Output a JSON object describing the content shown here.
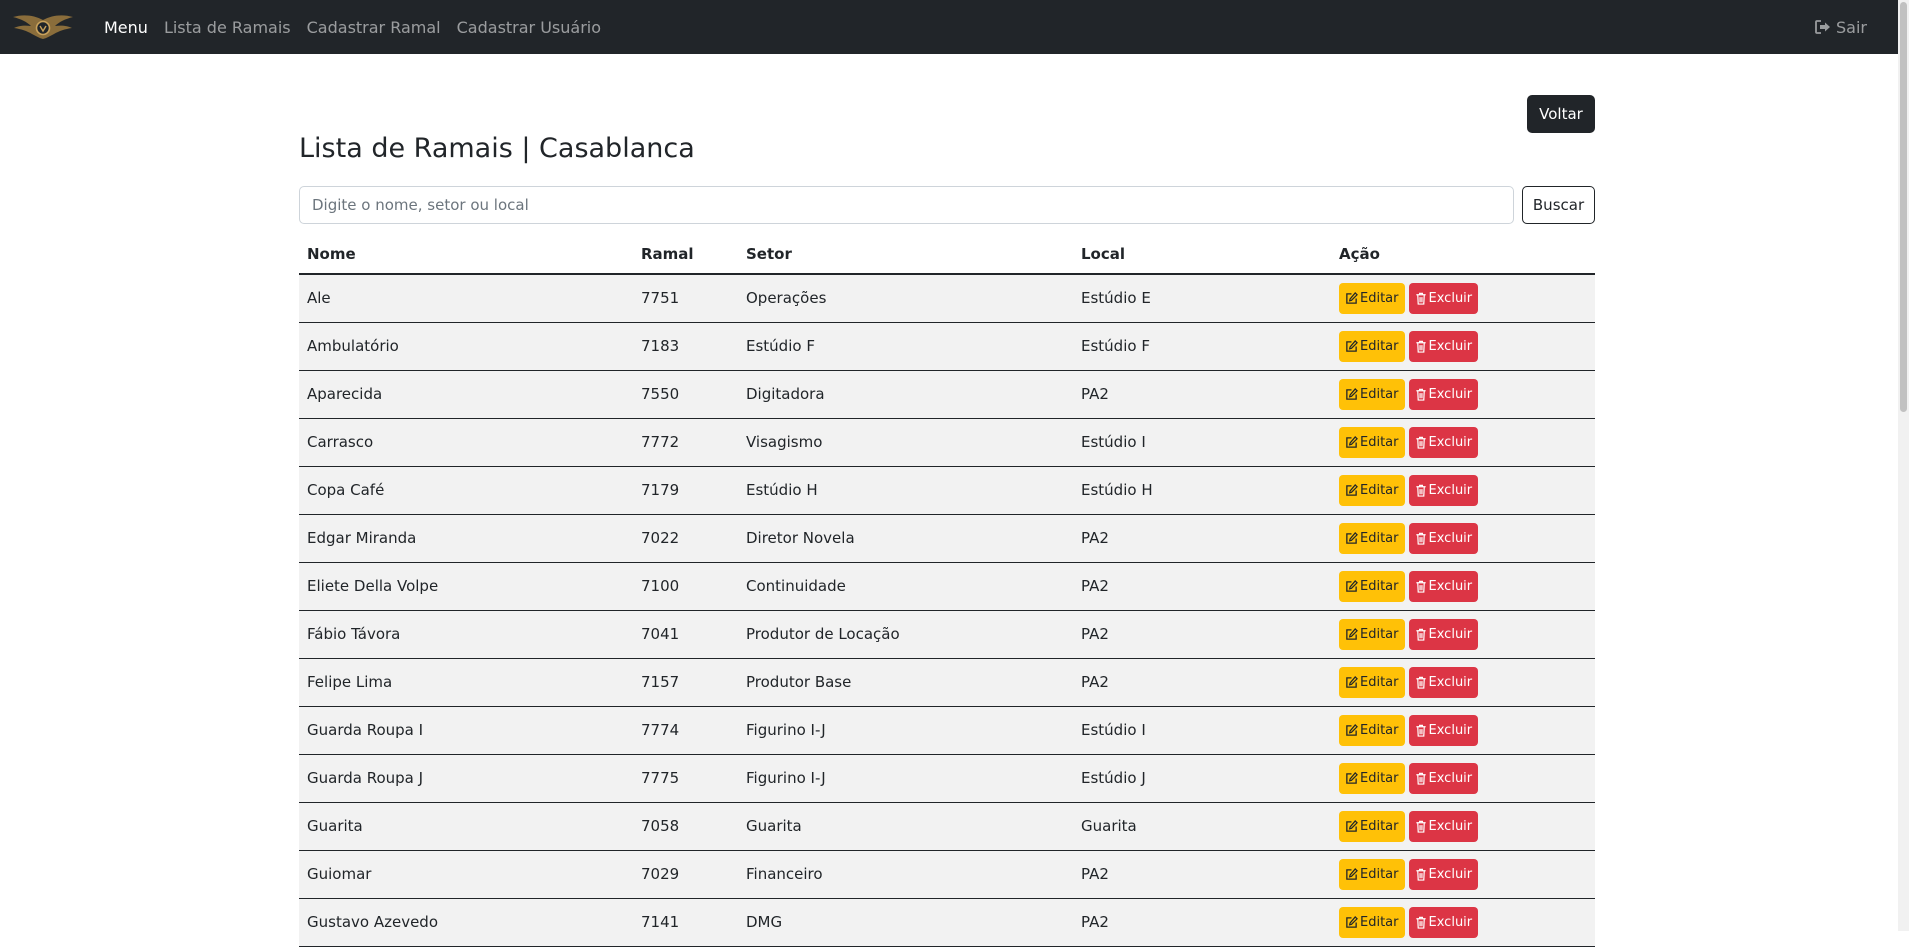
{
  "navbar": {
    "brand_icon": "winged-emblem-logo",
    "links": [
      {
        "label": "Menu",
        "active": true
      },
      {
        "label": "Lista de Ramais",
        "active": false
      },
      {
        "label": "Cadastrar Ramal",
        "active": false
      },
      {
        "label": "Cadastrar Usuário",
        "active": false
      }
    ],
    "logout_label": "Sair",
    "logout_icon": "sign-out-icon"
  },
  "main": {
    "back_label": "Voltar",
    "title": "Lista de Ramais | Casablanca",
    "search_placeholder": "Digite o nome, setor ou local",
    "search_value": "",
    "search_label": "Buscar"
  },
  "table": {
    "headers": [
      "Nome",
      "Ramal",
      "Setor",
      "Local",
      "Ação"
    ],
    "edit_label": "Editar",
    "delete_label": "Excluir",
    "rows": [
      [
        "Ale",
        "7751",
        "Operações",
        "Estúdio E"
      ],
      [
        "Ambulatório",
        "7183",
        "Estúdio F",
        "Estúdio F"
      ],
      [
        "Aparecida",
        "7550",
        "Digitadora",
        "PA2"
      ],
      [
        "Carrasco",
        "7772",
        "Visagismo",
        "Estúdio I"
      ],
      [
        "Copa Café",
        "7179",
        "Estúdio H",
        "Estúdio H"
      ],
      [
        "Edgar Miranda",
        "7022",
        "Diretor Novela",
        "PA2"
      ],
      [
        "Eliete Della Volpe",
        "7100",
        "Continuidade",
        "PA2"
      ],
      [
        "Fábio Távora",
        "7041",
        "Produtor de Locação",
        "PA2"
      ],
      [
        "Felipe Lima",
        "7157",
        "Produtor Base",
        "PA2"
      ],
      [
        "Guarda Roupa I",
        "7774",
        "Figurino I-J",
        "Estúdio I"
      ],
      [
        "Guarda Roupa J",
        "7775",
        "Figurino I-J",
        "Estúdio J"
      ],
      [
        "Guarita",
        "7058",
        "Guarita",
        "Guarita"
      ],
      [
        "Guiomar",
        "7029",
        "Financeiro",
        "PA2"
      ],
      [
        "Gustavo Azevedo",
        "7141",
        "DMG",
        "PA2"
      ]
    ]
  },
  "colors": {
    "navbar_bg": "#212529",
    "edit_button": "#ffc107",
    "delete_button": "#dc3545",
    "row_bg": "#f2f2f2"
  }
}
